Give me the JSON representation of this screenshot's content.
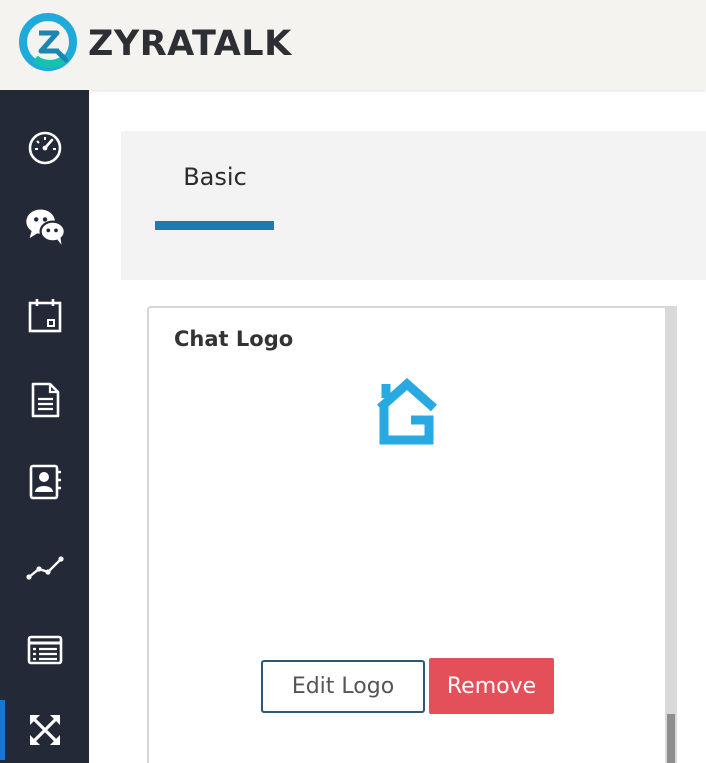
{
  "app": {
    "brand_name": "ZYRATALK",
    "brand_colors": {
      "ring": "#1faad9",
      "ring_dark": "#1b86b4",
      "accent": "#17c1b0"
    }
  },
  "sidebar": {
    "background": "#232937",
    "active_indicator_color": "#1976d2",
    "items": [
      {
        "icon": "speedometer-icon",
        "active": false
      },
      {
        "icon": "chat-bubbles-icon",
        "active": false
      },
      {
        "icon": "calendar-icon",
        "active": false
      },
      {
        "icon": "document-icon",
        "active": false
      },
      {
        "icon": "contacts-icon",
        "active": false
      },
      {
        "icon": "analytics-line-icon",
        "active": false
      },
      {
        "icon": "list-icon",
        "active": false
      },
      {
        "icon": "expand-arrows-icon",
        "active": true
      }
    ]
  },
  "tabs": [
    {
      "label": "Basic",
      "active": true,
      "indicator_color": "#1a7bb5"
    }
  ],
  "card": {
    "title": "Chat Logo",
    "logo_icon": "house-g-logo-icon",
    "logo_color": "#29a9e1",
    "edit_button_label": "Edit Logo",
    "remove_button_label": "Remove",
    "remove_button_color": "#e4505a"
  }
}
